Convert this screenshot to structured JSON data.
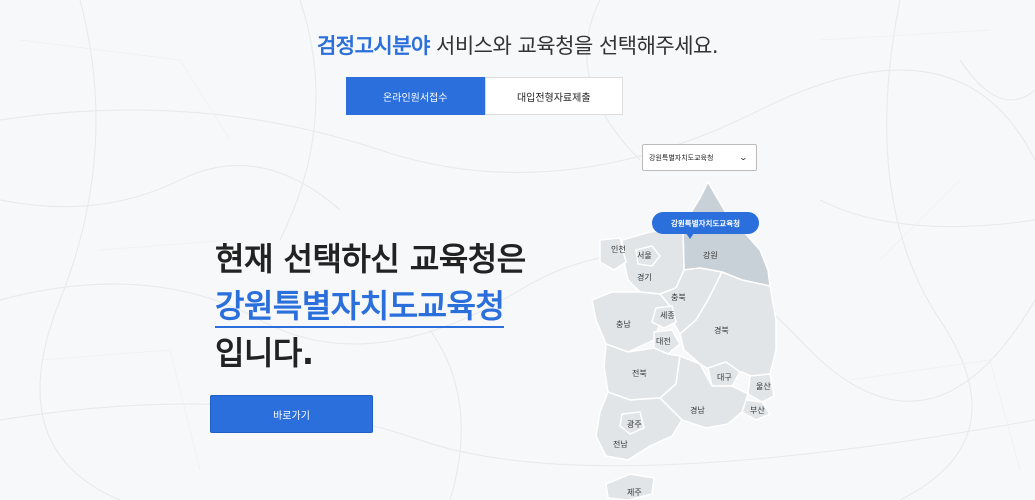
{
  "header": {
    "title_accent": "검정고시분야",
    "title_rest": " 서비스와 교육청을 선택해주세요."
  },
  "tabs": [
    {
      "label": "온라인원서접수",
      "active": true
    },
    {
      "label": "대입전형자료제출",
      "active": false
    }
  ],
  "office_select": {
    "selected": "강원특별자치도교육청"
  },
  "headline": {
    "line1": "현재 선택하신 교육청은",
    "office": "강원특별자치도교육청",
    "line3": "입니다."
  },
  "go_button": {
    "label": "바로가기"
  },
  "map": {
    "selected_pin": "강원특별자치도교육청",
    "regions": {
      "incheon": "인천",
      "seoul": "서울",
      "gyeonggi": "경기",
      "gangwon": "강원",
      "chungbuk": "충북",
      "sejong": "세종",
      "chungnam": "충남",
      "daejeon": "대전",
      "gyeongbuk": "경북",
      "jeonbuk": "전북",
      "daegu": "대구",
      "ulsan": "울산",
      "busan": "부산",
      "gyeongnam": "경남",
      "gwangju": "광주",
      "jeonnam": "전남",
      "jeju": "제주"
    }
  },
  "colors": {
    "accent": "#2a6fdb",
    "region_fill": "#e1e5e8",
    "selected_region_fill": "#c9d1d8",
    "background": "#f7f8f9"
  }
}
